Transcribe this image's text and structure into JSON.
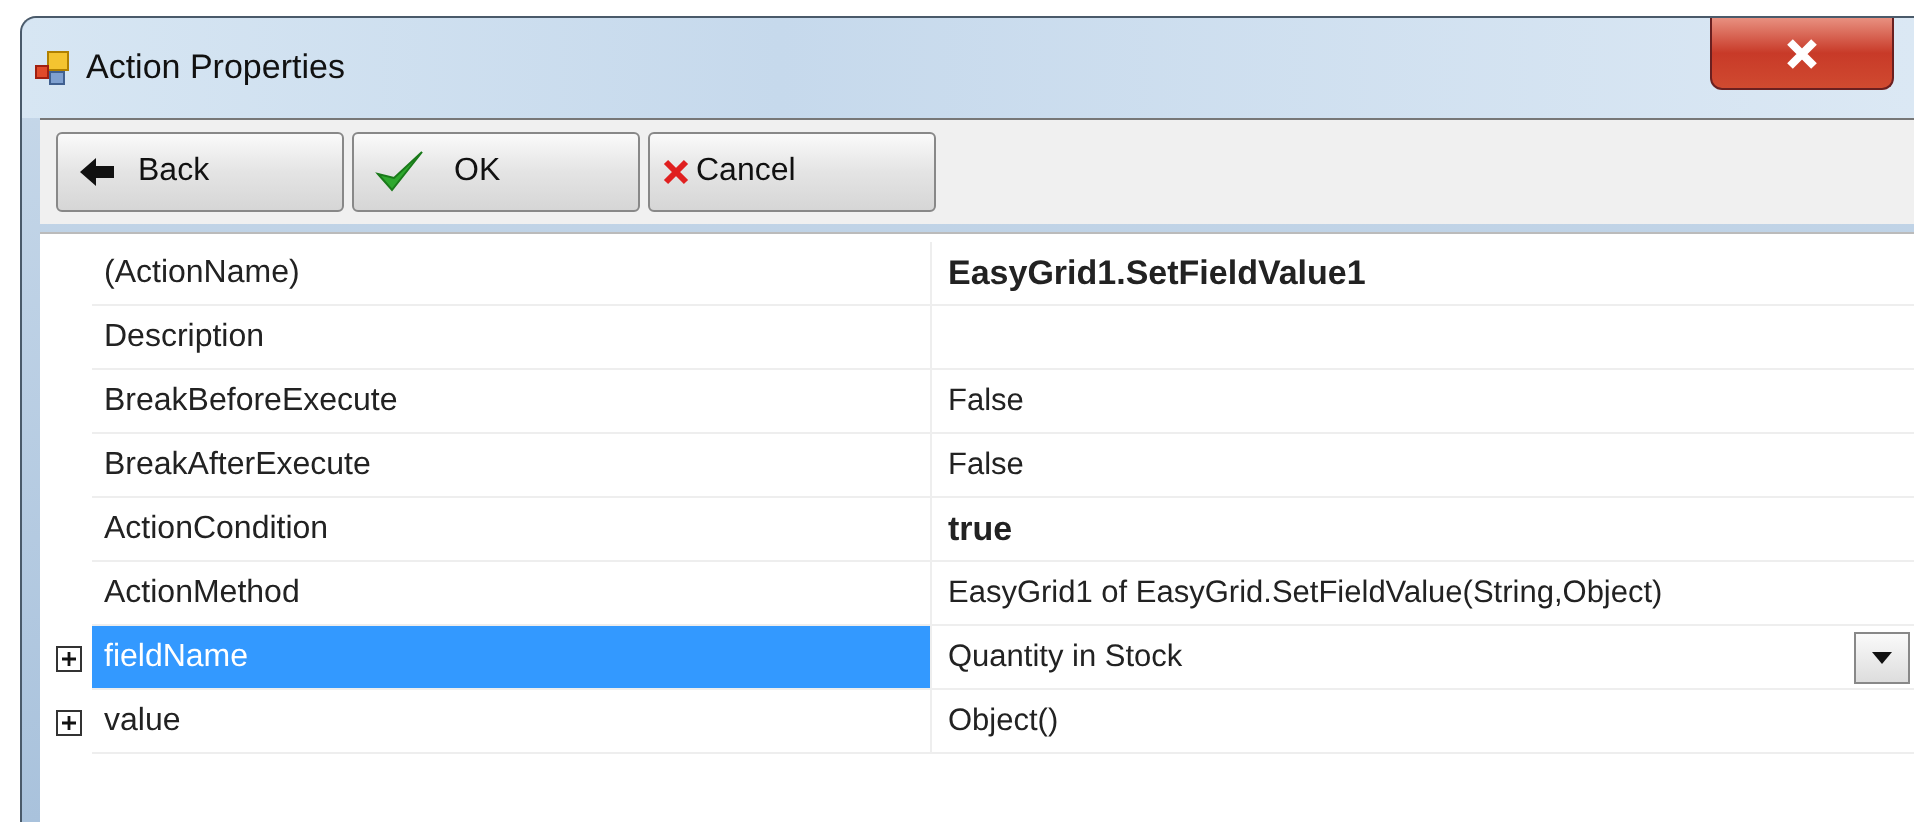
{
  "window": {
    "title": "Action Properties"
  },
  "toolbar": [
    {
      "kind": "back",
      "label": "Back"
    },
    {
      "kind": "ok",
      "label": "OK"
    },
    {
      "kind": "cancel",
      "label": "Cancel"
    }
  ],
  "properties": [
    {
      "name": "(ActionName)",
      "value": "EasyGrid1.SetFieldValue1",
      "bold": true,
      "expandable": false,
      "selected": false
    },
    {
      "name": "Description",
      "bold": false,
      "expandable": false,
      "selected": false
    },
    {
      "name": "BreakBeforeExecute",
      "value": "False",
      "bold": false,
      "expandable": false,
      "selected": false
    },
    {
      "name": "BreakAfterExecute",
      "value": "False",
      "bold": false,
      "expandable": false,
      "selected": false
    },
    {
      "name": "ActionCondition",
      "value": "true",
      "bold": true,
      "expandable": false,
      "selected": false
    },
    {
      "name": "ActionMethod",
      "value": "EasyGrid1 of EasyGrid.SetFieldValue(String,Object)",
      "bold": false,
      "expandable": false,
      "selected": false
    },
    {
      "name": "fieldName",
      "value": "Quantity in Stock",
      "bold": false,
      "expandable": true,
      "selected": true
    },
    {
      "name": "value",
      "value": "Object()",
      "bold": false,
      "expandable": true,
      "selected": false
    }
  ]
}
